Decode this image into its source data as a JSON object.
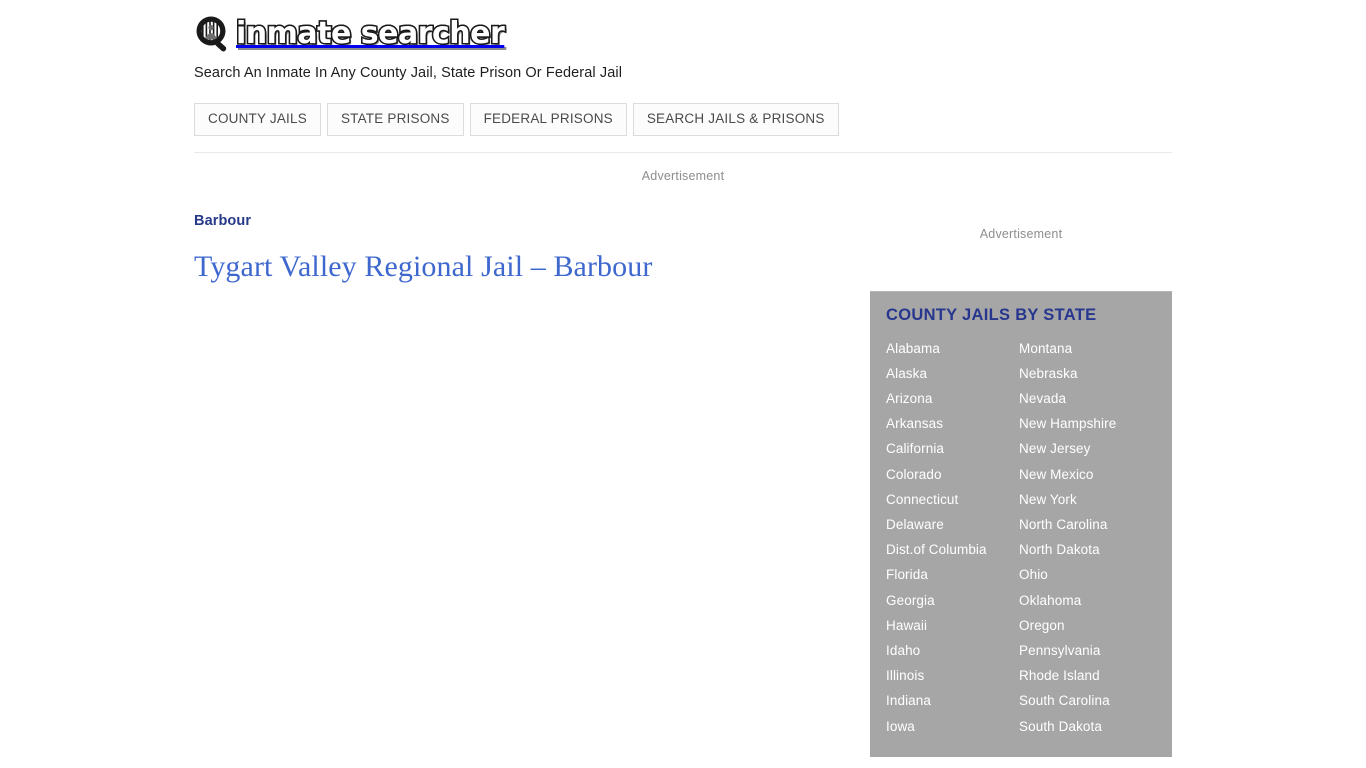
{
  "site": {
    "logo_icon": "magnifying-glass-jail-icon",
    "wordmark": "inmate searcher",
    "tagline": "Search An Inmate In Any County Jail, State Prison Or Federal Jail"
  },
  "nav": {
    "items": [
      {
        "label": "COUNTY JAILS"
      },
      {
        "label": "STATE PRISONS"
      },
      {
        "label": "FEDERAL PRISONS"
      },
      {
        "label": "SEARCH JAILS & PRISONS"
      }
    ]
  },
  "ads": {
    "top_label": "Advertisement",
    "sidebar_label": "Advertisement"
  },
  "article": {
    "category": "Barbour",
    "title": "Tygart Valley Regional Jail – Barbour"
  },
  "sidebar": {
    "widget_title": "COUNTY JAILS BY STATE",
    "states_left": [
      "Alabama",
      "Alaska",
      "Arizona",
      "Arkansas",
      "California",
      "Colorado",
      "Connecticut",
      "Delaware",
      "Dist.of Columbia",
      "Florida",
      "Georgia",
      "Hawaii",
      "Idaho",
      "Illinois",
      "Indiana",
      "Iowa"
    ],
    "states_right": [
      "Montana",
      "Nebraska",
      "Nevada",
      "New Hampshire",
      "New Jersey",
      "New Mexico",
      "New York",
      "North Carolina",
      "North Dakota",
      "Ohio",
      "Oklahoma",
      "Oregon",
      "Pennsylvania",
      "Rhode Island",
      "South Carolina",
      "South Dakota"
    ]
  },
  "colors": {
    "widget_bg": "#a6a6a6",
    "widget_title": "#27368e",
    "category": "#273a8a",
    "title_link": "#3f68cf",
    "nav_border": "#dcdcdc",
    "ad_label": "#8d8d8d"
  }
}
